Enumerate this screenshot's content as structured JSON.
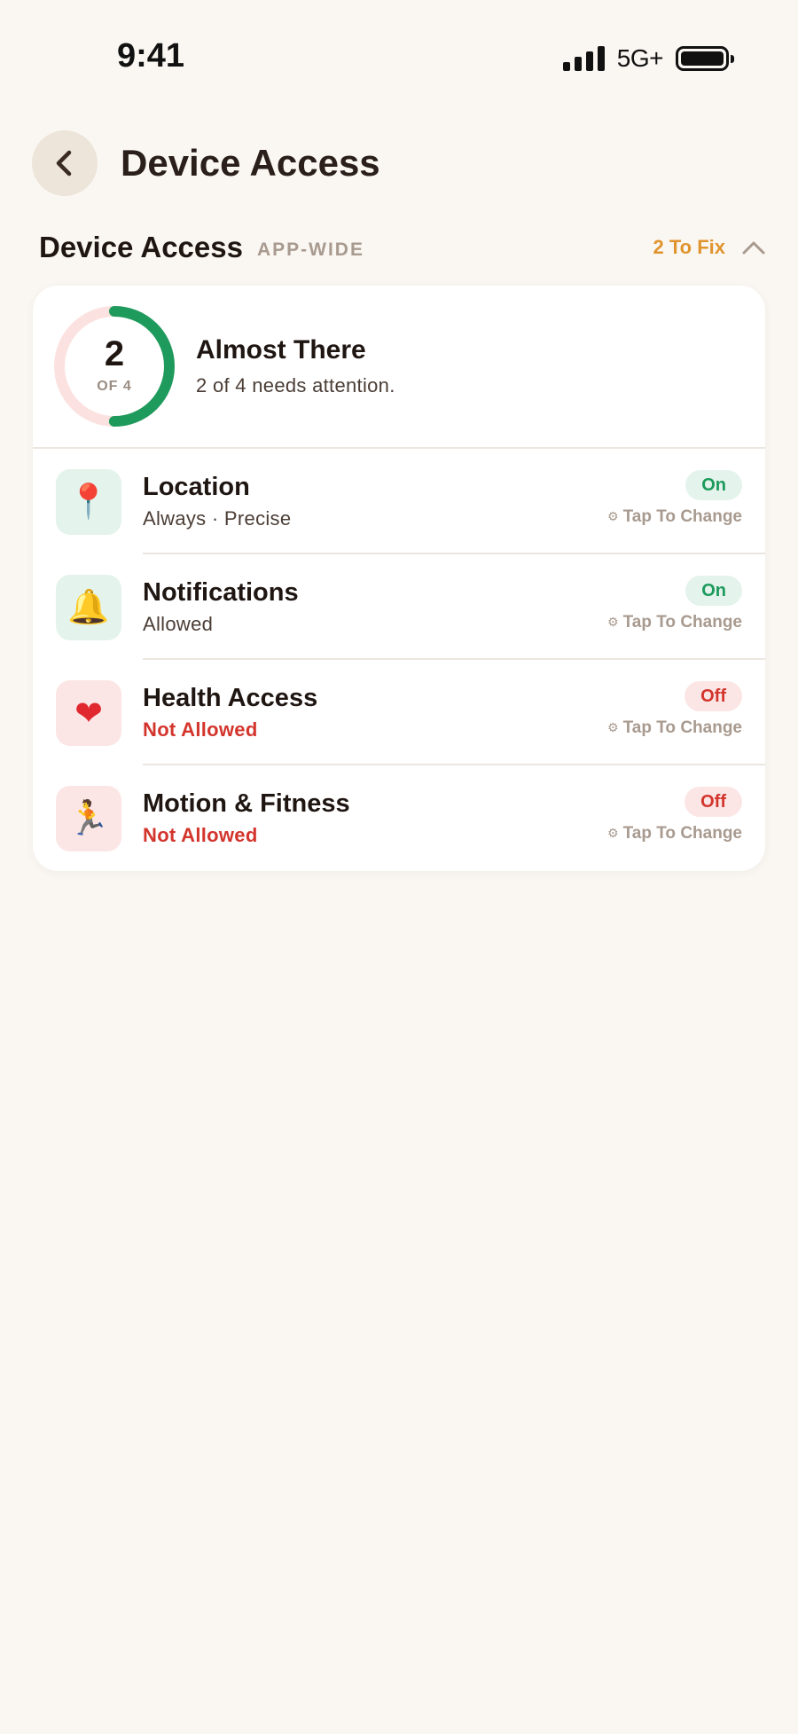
{
  "status_bar": {
    "time": "9:41",
    "network": "5G+"
  },
  "nav": {
    "title": "Device Access",
    "back_icon": "chevron-left-icon"
  },
  "section": {
    "title": "Device Access",
    "tag": "APP-WIDE",
    "fix_label": "2 To Fix",
    "collapse_icon": "chevron-up-icon"
  },
  "summary": {
    "count": "2",
    "of_label": "OF 4",
    "progress_fraction": 0.5,
    "title": "Almost There",
    "subtitle": "2 of 4 needs attention."
  },
  "permissions": [
    {
      "name": "Location",
      "status": "Always · Precise",
      "state": "On",
      "ok": true,
      "icon": "📍",
      "icon_name": "pin-icon",
      "action": "Tap To Change"
    },
    {
      "name": "Notifications",
      "status": "Allowed",
      "state": "On",
      "ok": true,
      "icon": "🔔",
      "icon_name": "bell-icon",
      "action": "Tap To Change"
    },
    {
      "name": "Health Access",
      "status": "Not Allowed",
      "state": "Off",
      "ok": false,
      "icon": "❤",
      "icon_name": "heart-icon",
      "action": "Tap To Change"
    },
    {
      "name": "Motion & Fitness",
      "status": "Not Allowed",
      "state": "Off",
      "ok": false,
      "icon": "🏃",
      "icon_name": "runner-icon",
      "action": "Tap To Change"
    }
  ],
  "colors": {
    "background": "#faf7f2",
    "accent_green": "#1d9a5c",
    "accent_red": "#d3352d",
    "accent_orange": "#e0942e"
  }
}
